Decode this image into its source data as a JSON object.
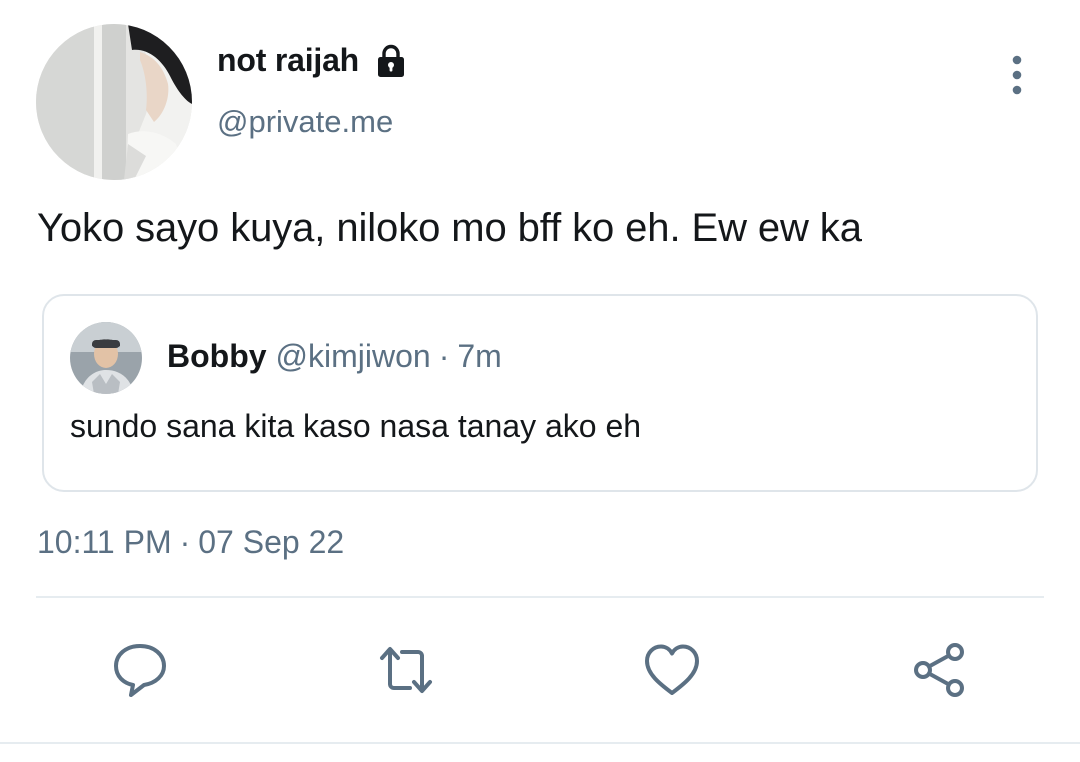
{
  "author": {
    "display_name": "not raijah",
    "handle": "@private.me",
    "protected_icon": "lock-icon",
    "avatar": "avatar-photo"
  },
  "menu": {
    "icon": "more-vertical-icon"
  },
  "tweet": {
    "text": "Yoko sayo kuya, niloko mo bff ko eh. Ew ew ka"
  },
  "quoted_tweet": {
    "display_name": "Bobby",
    "handle": "@kimjiwon",
    "separator": "·",
    "time": "7m",
    "text": "sundo sana kita kaso nasa tanay ako eh",
    "avatar": "avatar-photo"
  },
  "timestamp": {
    "time": "10:11 PM",
    "separator": "·",
    "date": "07 Sep 22"
  },
  "actions": [
    {
      "icon": "reply-icon"
    },
    {
      "icon": "retweet-icon"
    },
    {
      "icon": "like-heart-icon"
    },
    {
      "icon": "share-icon"
    }
  ],
  "colors": {
    "text_primary": "#14171a",
    "text_secondary": "#5b7083",
    "border": "#dfe5ea",
    "icon": "#5b7083"
  }
}
